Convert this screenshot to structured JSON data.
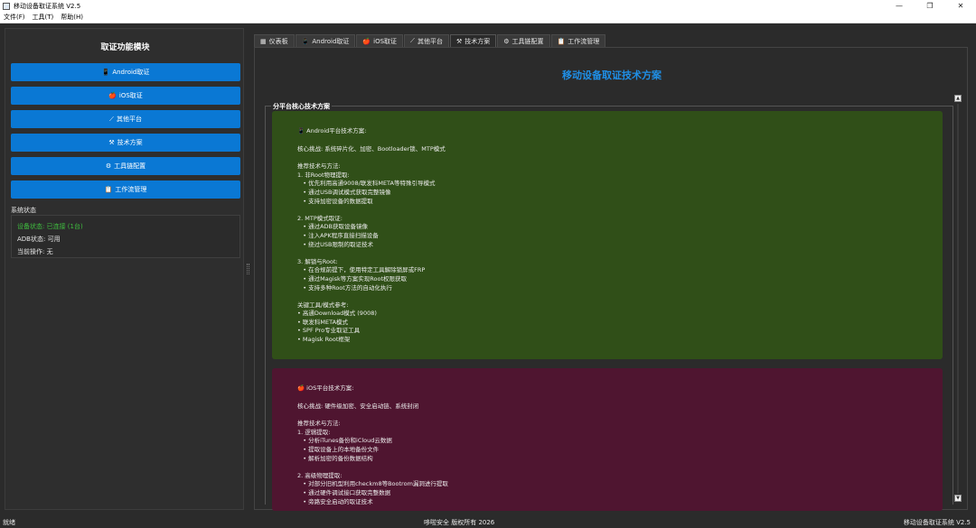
{
  "window": {
    "title": "移动设备取证系统 V2.5",
    "minimize": "—",
    "maximize": "❐",
    "close": "✕"
  },
  "menu": [
    "文件(F)",
    "工具(T)",
    "帮助(H)"
  ],
  "sidebar": {
    "title": "取证功能模块",
    "buttons": [
      {
        "icon": "📱",
        "label": "Android取证"
      },
      {
        "icon": "🍎",
        "label": "iOS取证"
      },
      {
        "icon": "⟋",
        "label": "其他平台"
      },
      {
        "icon": "⚒",
        "label": "技术方案"
      },
      {
        "icon": "⚙",
        "label": "工具链配置"
      },
      {
        "icon": "📋",
        "label": "工作流管理"
      }
    ],
    "status_title": "系统状态",
    "status": {
      "device": "设备状态: 已连接 (1台)",
      "adb": "ADB状态: 可用",
      "operation": "当前操作: 无"
    },
    "colors": {
      "button": "#0a78d4",
      "connected": "#3fbf3f"
    }
  },
  "tabs": [
    {
      "icon": "▦",
      "label": "仪表板"
    },
    {
      "icon": "📱",
      "label": "Android取证"
    },
    {
      "icon": "🍎",
      "label": "iOS取证"
    },
    {
      "icon": "⟋",
      "label": "其他平台"
    },
    {
      "icon": "⚒",
      "label": "技术方案"
    },
    {
      "icon": "⚙",
      "label": "工具链配置"
    },
    {
      "icon": "📋",
      "label": "工作流管理"
    }
  ],
  "active_tab": 4,
  "main": {
    "page_title": "移动设备取证技术方案",
    "group_title": "分平台核心技术方案",
    "android": {
      "heading": "📱 Android平台技术方案:",
      "lines": [
        "核心挑战: 系统碎片化、加密、Bootloader锁、MTP模式",
        "",
        "推荐技术与方法:",
        "1. 非Root物理提取:",
        "   • 优先利用高通9008/联发科META等特殊引导模式",
        "   • 通过USB调试模式获取完整镜像",
        "   • 支持加密设备的数据提取",
        "",
        "2. MTP模式取证:",
        "   • 通过ADB获取设备镜像",
        "   • 注入APK程序直接扫描设备",
        "   • 绕过USB限制的取证技术",
        "",
        "3. 解锁与Root:",
        "   • 在合规前提下，使用特定工具解除锁屏或FRP",
        "   • 通过Magisk等方案实现Root权限获取",
        "   • 支持多种Root方法的自动化执行",
        "",
        "关键工具/模式参考:",
        "• 高通Download模式 (9008)",
        "• 联发科META模式",
        "• SPF Pro专业取证工具",
        "• Magisk Root框架"
      ]
    },
    "ios": {
      "heading": "🍎 iOS平台技术方案:",
      "lines": [
        "核心挑战: 硬件级加密、安全启动链、系统封闭",
        "",
        "推荐技术与方法:",
        "1. 逻辑提取:",
        "   • 分析iTunes备份和iCloud云数据",
        "   • 提取设备上的本地备份文件",
        "   • 解析加密的备份数据结构",
        "",
        "2. 高级物理提取:",
        "   • 对部分旧机型利用checkm8等Bootrom漏洞进行提取",
        "   • 通过硬件调试接口获取完整数据",
        "   • 旁路安全启动的取证技术"
      ]
    },
    "colors": {
      "title": "#1f8fe6",
      "android_card": "#304f18",
      "ios_card": "#4f1530"
    }
  },
  "statusbar": {
    "left": "就绪",
    "center": "哆啦安全 版权所有 2026",
    "right": "移动设备取证系统 V2.5"
  }
}
